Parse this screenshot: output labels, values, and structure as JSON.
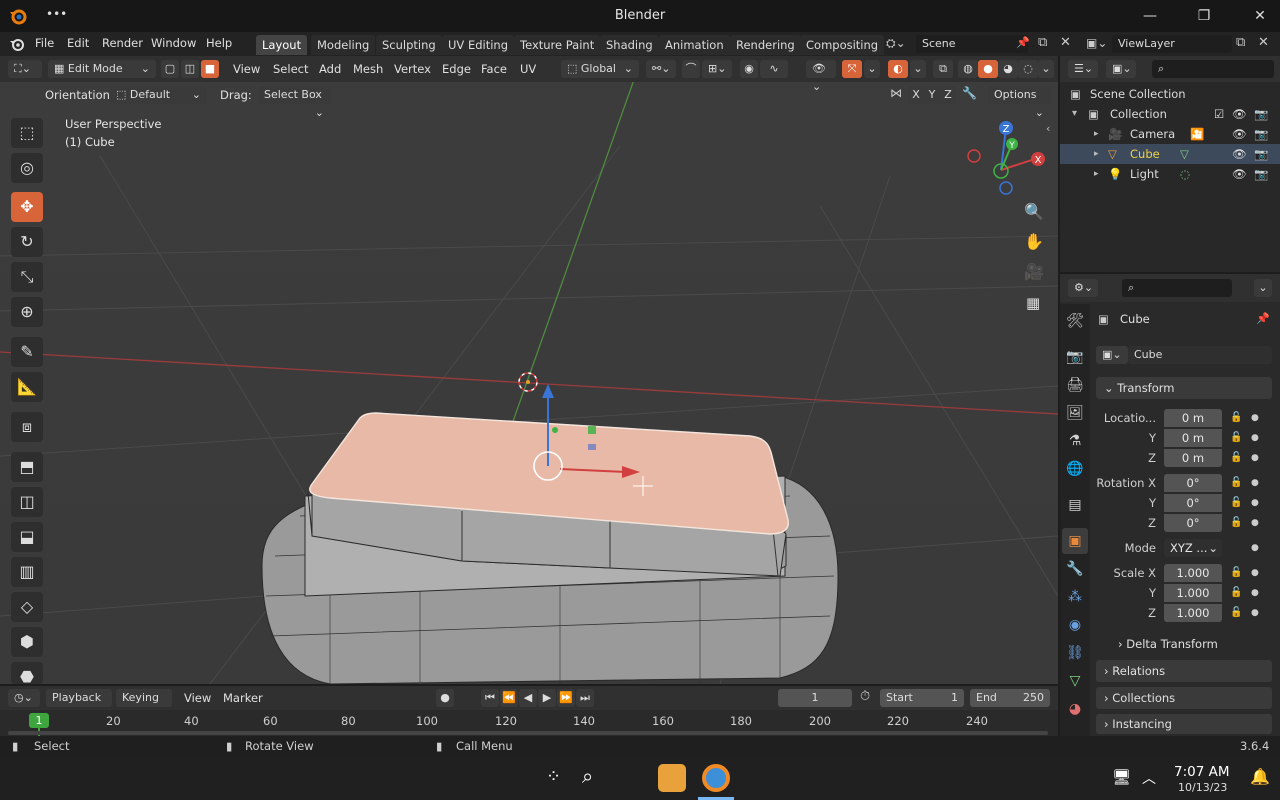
{
  "window": {
    "title": "Blender",
    "minimize": "—",
    "maximize": "❐",
    "close": "✕",
    "menu_dots": "•••"
  },
  "menu": [
    "File",
    "Edit",
    "Render",
    "Window",
    "Help"
  ],
  "workspaces": [
    "Layout",
    "Modeling",
    "Sculpting",
    "UV Editing",
    "Texture Paint",
    "Shading",
    "Animation",
    "Rendering",
    "Compositing"
  ],
  "scene": {
    "label": "Scene",
    "viewlayer": "ViewLayer"
  },
  "viewport_header": {
    "mode": "Edit Mode",
    "items": [
      "View",
      "Select",
      "Add",
      "Mesh",
      "Vertex",
      "Edge",
      "Face",
      "UV"
    ],
    "transform_orientation": "Global"
  },
  "tool_header": {
    "orientation_label": "Orientation:",
    "orientation_value": "Default",
    "drag_label": "Drag:",
    "drag_value": "Select Box",
    "axes": [
      "X",
      "Y",
      "Z"
    ],
    "options": "Options"
  },
  "viewport": {
    "perspective": "User Perspective",
    "object": "(1) Cube",
    "gizmo": {
      "x": "X",
      "y": "Y",
      "z": "Z"
    }
  },
  "outliner": {
    "root": "Scene Collection",
    "collection": "Collection",
    "items": [
      {
        "name": "Camera",
        "color": "#dcdcdc"
      },
      {
        "name": "Cube",
        "color": "#f0d04a"
      },
      {
        "name": "Light",
        "color": "#dcdcdc"
      }
    ]
  },
  "properties": {
    "object_name": "Cube",
    "data_name": "Cube",
    "transform_title": "Transform",
    "location_label": "Locatio...",
    "location": [
      "0 m",
      "0 m",
      "0 m"
    ],
    "rotation_label": "Rotation X",
    "rotation": [
      "0°",
      "0°",
      "0°"
    ],
    "mode_label": "Mode",
    "mode_value": "XYZ ...",
    "scale_label": "Scale X",
    "scale": [
      "1.000",
      "1.000",
      "1.000"
    ],
    "axis_y": "Y",
    "axis_z": "Z",
    "delta": "Delta Transform",
    "sections": [
      "Relations",
      "Collections",
      "Instancing"
    ]
  },
  "timeline": {
    "menus": [
      "Playback",
      "Keying",
      "View",
      "Marker"
    ],
    "current_frame": "1",
    "start_label": "Start",
    "start": "1",
    "end_label": "End",
    "end": "250",
    "frame_marker": "1",
    "ticks": [
      "20",
      "40",
      "60",
      "80",
      "100",
      "120",
      "140",
      "160",
      "180",
      "200",
      "220",
      "240"
    ]
  },
  "statusbar": {
    "select": "Select",
    "rotate": "Rotate View",
    "callmenu": "Call Menu",
    "version": "3.6.4"
  },
  "taskbar": {
    "time": "7:07 AM",
    "date": "10/13/23"
  },
  "colors": {
    "accent": "#d8643a",
    "active_object": "#f0d04a",
    "selected_face": "#e8b9a7"
  }
}
